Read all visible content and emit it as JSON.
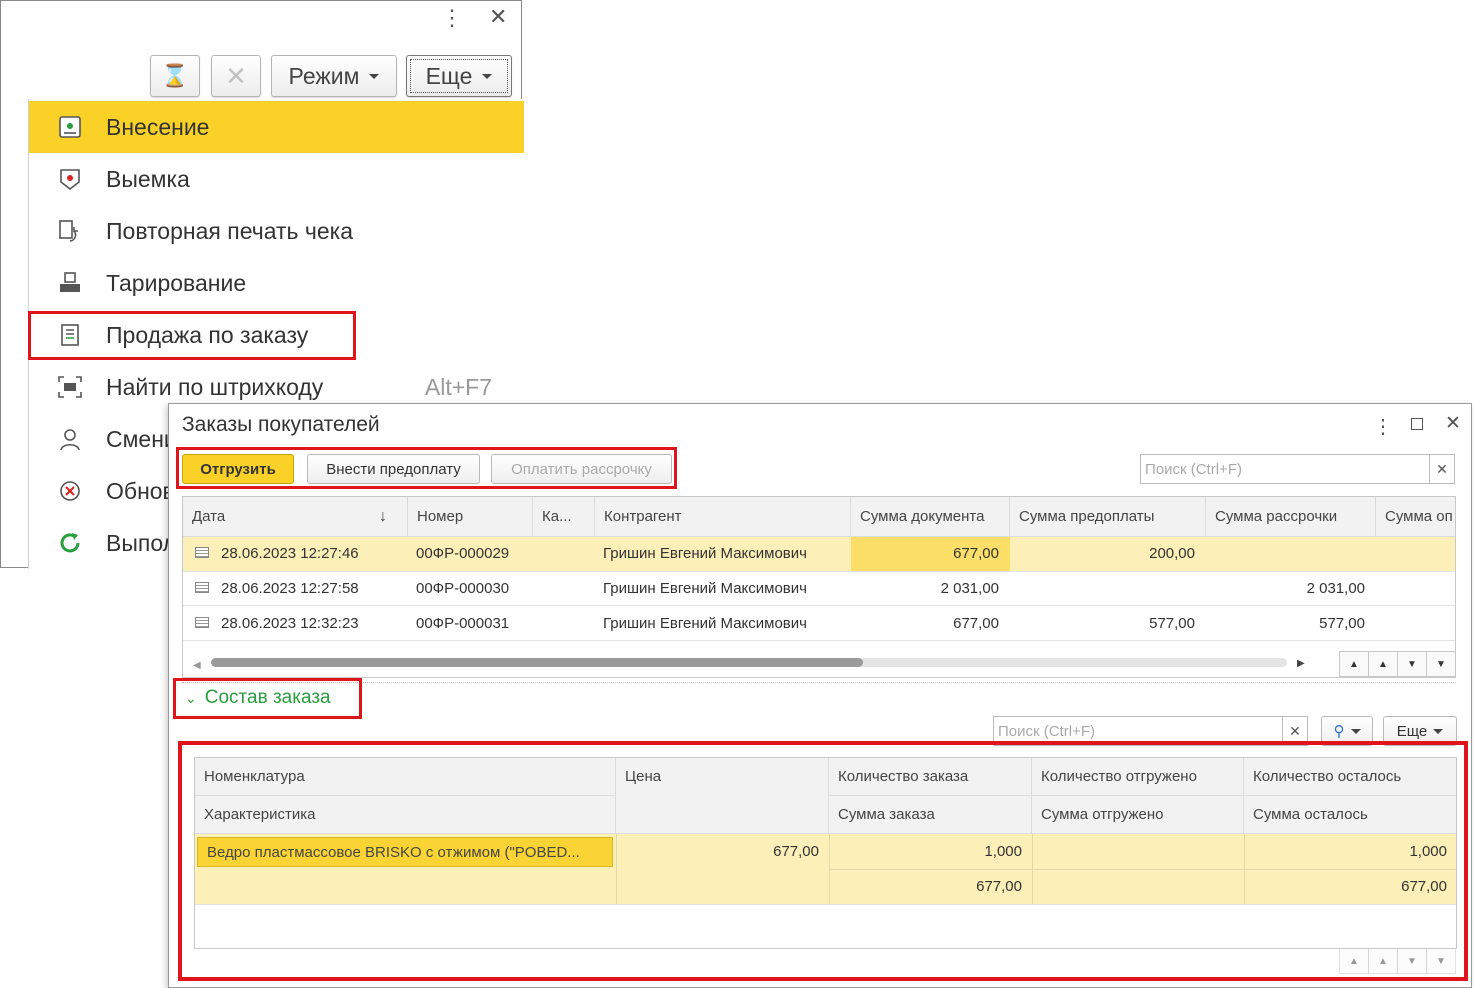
{
  "back_window": {
    "toolbar": {
      "mode_label": "Режим",
      "more_label": "Еще"
    },
    "menu": [
      {
        "label": "Внесение",
        "icon": "cash-in-icon",
        "shortcut": ""
      },
      {
        "label": "Выемка",
        "icon": "cash-out-icon",
        "shortcut": ""
      },
      {
        "label": "Повторная печать чека",
        "icon": "reprint-receipt-icon",
        "shortcut": ""
      },
      {
        "label": "Тарирование",
        "icon": "scale-icon",
        "shortcut": ""
      },
      {
        "label": "Продажа по заказу",
        "icon": "order-document-icon",
        "shortcut": ""
      },
      {
        "label": "Найти по штрихкоду",
        "icon": "barcode-scan-icon",
        "shortcut": "Alt+F7"
      },
      {
        "label": "Смени",
        "icon": "user-icon",
        "shortcut": ""
      },
      {
        "label": "Обнов",
        "icon": "refresh-cancel-icon",
        "shortcut": ""
      },
      {
        "label": "Выпол",
        "icon": "refresh-green-icon",
        "shortcut": ""
      }
    ]
  },
  "front_window": {
    "title": "Заказы покупателей",
    "toolbar": {
      "ship_label": "Отгрузить",
      "prepay_label": "Внести предоплату",
      "installment_label": "Оплатить рассрочку",
      "search_placeholder": "Поиск (Ctrl+F)"
    },
    "orders_table": {
      "columns": [
        "Дата",
        "Номер",
        "Ка...",
        "Контрагент",
        "Сумма документа",
        "Сумма предоплаты",
        "Сумма рассрочки",
        "Сумма оп"
      ],
      "rows": [
        {
          "date": "28.06.2023 12:27:46",
          "number": "00ФР-000029",
          "ka": "",
          "contractor": "Гришин Евгений Максимович",
          "doc_sum": "677,00",
          "prepay_sum": "200,00",
          "installment_sum": "",
          "paid_sum": ""
        },
        {
          "date": "28.06.2023 12:27:58",
          "number": "00ФР-000030",
          "ka": "",
          "contractor": "Гришин Евгений Максимович",
          "doc_sum": "2 031,00",
          "prepay_sum": "",
          "installment_sum": "2 031,00",
          "paid_sum": ""
        },
        {
          "date": "28.06.2023 12:32:23",
          "number": "00ФР-000031",
          "ka": "",
          "contractor": "Гришин Евгений Максимович",
          "doc_sum": "677,00",
          "prepay_sum": "577,00",
          "installment_sum": "577,00",
          "paid_sum": ""
        }
      ]
    },
    "order_section": {
      "title": "Состав заказа",
      "search_placeholder": "Поиск (Ctrl+F)",
      "more_label": "Еще",
      "columns_row1": [
        "Номенклатура",
        "Цена",
        "Количество заказа",
        "Количество отгружено",
        "Количество осталось"
      ],
      "columns_row2": [
        "Характеристика",
        "Сумма заказа",
        "Сумма отгружено",
        "Сумма осталось"
      ],
      "item": {
        "name": "Ведро пластмассовое BRISKO с отжимом (\"POBED...",
        "characteristic": "",
        "price": "677,00",
        "qty_ordered": "1,000",
        "qty_shipped": "",
        "qty_left": "1,000",
        "sum_ordered": "677,00",
        "sum_shipped": "",
        "sum_left": "677,00"
      }
    }
  },
  "colors": {
    "highlight": "#fad227",
    "row_selected": "#fcefb8",
    "accent_red": "#e0141b",
    "section_green": "#2a9d3f"
  }
}
